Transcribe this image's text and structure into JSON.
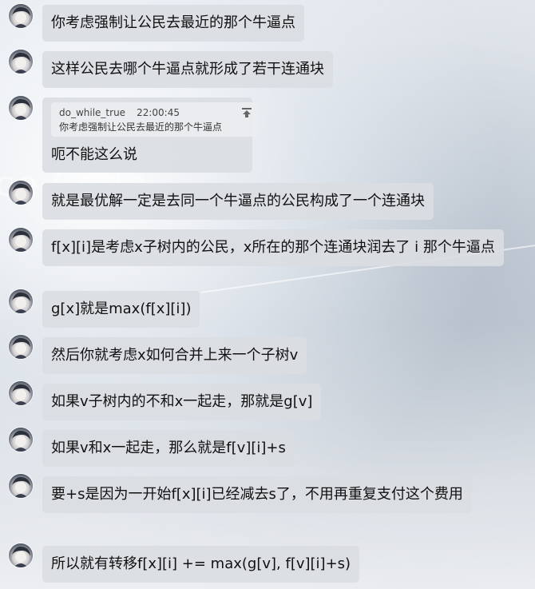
{
  "messages": [
    {
      "text": "你考虑强制让公民去最近的那个牛逼点"
    },
    {
      "text": "这样公民去哪个牛逼点就形成了若干连通块"
    },
    {
      "quote": {
        "author": "do_while_true",
        "time": "22:00:45",
        "text": "你考虑强制让公民去最近的那个牛逼点"
      },
      "text": "呃不能这么说"
    },
    {
      "text": "就是最优解一定是去同一个牛逼点的公民构成了一个连通块"
    },
    {
      "text": "f[x][i]是考虑x子树内的公民，x所在的那个连通块润去了 i 那个牛逼点"
    },
    {
      "text": "g[x]就是max(f[x][i])"
    },
    {
      "text": "然后你就考虑x如何合并上来一个子树v"
    },
    {
      "text": "如果v子树内的不和x一起走，那就是g[v]"
    },
    {
      "text": "如果v和x一起走，那么就是f[v][i]+s"
    },
    {
      "text": "要+s是因为一开始f[x][i]已经减去s了，不用再重复支付这个费用"
    },
    {
      "text": "所以就有转移f[x][i]  += max(g[v], f[v][i]+s)"
    }
  ],
  "icons": {
    "avatar": "avatar-icon",
    "pin": "pin-to-top-icon"
  }
}
